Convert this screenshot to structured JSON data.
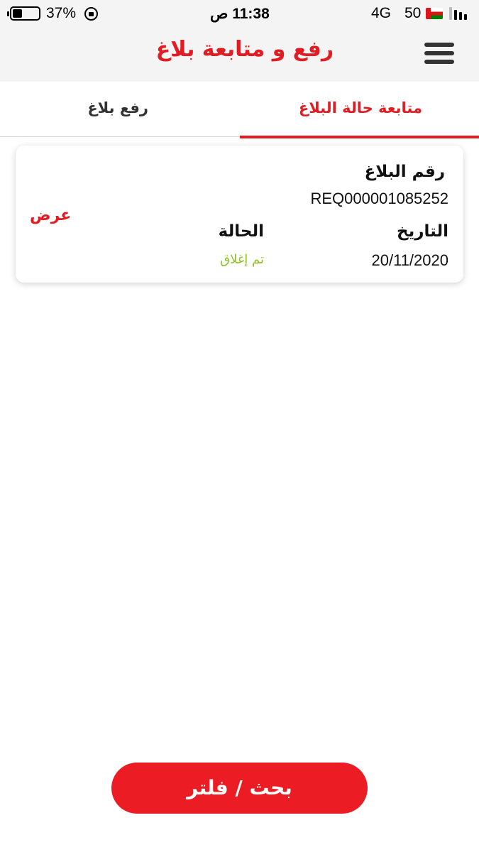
{
  "status_bar": {
    "battery_percent": "37%",
    "battery_level": 0.37,
    "time": "11:38 ص",
    "network": "4G",
    "carrier": "50",
    "icons": [
      "battery-icon",
      "rotation-lock-icon",
      "oman-flag-icon",
      "signal-icon"
    ]
  },
  "header": {
    "title": "رفع و متابعة بلاغ",
    "menu_icon": "hamburger-menu-icon"
  },
  "tabs": [
    {
      "label": "متابعة حالة البلاغ",
      "active": true
    },
    {
      "label": "رفع بلاغ",
      "active": false
    }
  ],
  "ticket": {
    "number_label": "رقم البلاغ",
    "number": "REQ000001085252",
    "date_label": "التاريخ",
    "date": "20/11/2020",
    "status_label": "الحالة",
    "status": "تم إغلاق",
    "view_label": "عرض"
  },
  "footer": {
    "filter_button": "بحث / فلتر"
  },
  "colors": {
    "accent": "#e31b23",
    "button": "#ec1c24",
    "status_closed": "#8cc21f",
    "bar_background": "#f4f4f4"
  }
}
